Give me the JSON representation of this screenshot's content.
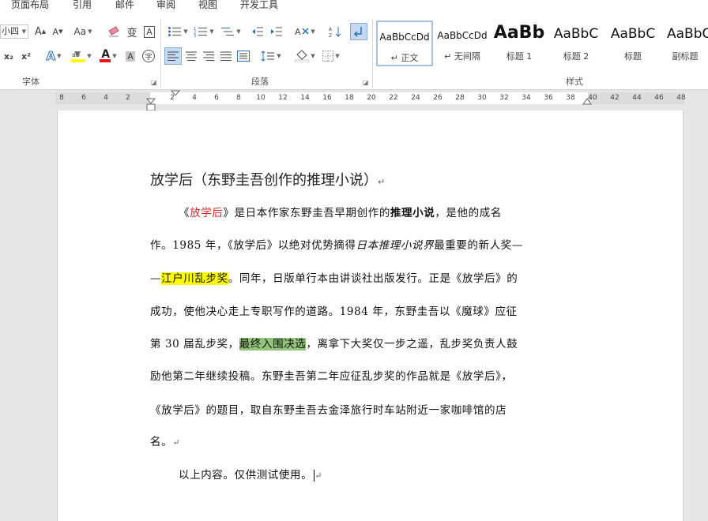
{
  "menu": {
    "tabs": [
      "页面布局",
      "引用",
      "邮件",
      "审阅",
      "视图",
      "开发工具"
    ]
  },
  "font_group": {
    "font_size": "小四",
    "grow_font": "A",
    "shrink_font": "A",
    "change_case": "Aa",
    "phonetic_guide": "变",
    "char_border": "A",
    "subscript": "x₂",
    "superscript": "x²",
    "text_effects": "A",
    "font_color": "A",
    "char_shading": "A",
    "enclose_char": "字",
    "label": "字体"
  },
  "paragraph_group": {
    "label": "段落"
  },
  "styles_group": {
    "label": "样式",
    "items": [
      {
        "sample": "AaBbCcDd",
        "name": "↵ 正文"
      },
      {
        "sample": "AaBbCcDd",
        "name": "↵ 无间隔"
      },
      {
        "sample": "AaBb",
        "name": "标题 1"
      },
      {
        "sample": "AaBbC",
        "name": "标题 2"
      },
      {
        "sample": "AaBbC",
        "name": "标题"
      },
      {
        "sample": "AaBbC",
        "name": "副标题"
      }
    ]
  },
  "ruler": {
    "ticks": [
      "8",
      "6",
      "4",
      "2",
      "2",
      "4",
      "6",
      "8",
      "10",
      "12",
      "14",
      "16",
      "18",
      "20",
      "22",
      "24",
      "26",
      "28",
      "30",
      "32",
      "34",
      "36",
      "38",
      "40",
      "42",
      "44",
      "46",
      "48"
    ]
  },
  "document": {
    "title": "放学后（东野圭吾创作的推理小说）",
    "title_mark": "↵",
    "p1_l1": [
      "《",
      "放学后",
      "》是日本作家东野圭吾早期创作的",
      "推理小说",
      "，是他的成名"
    ],
    "p1_l2": [
      "作。1985 年，《放学后》以绝对优势摘得",
      "日本推理小说界",
      "最重要的新人奖—"
    ],
    "p1_l3": [
      "—",
      "江户川乱步奖",
      "。同年，日版单行本由讲谈社出版发行。正是《放学后》的"
    ],
    "p1_l4": "成功，使他决心走上专职写作的道路。1984 年，东野圭吾以《魔球》应征",
    "p1_l5": [
      "第 30 届乱步奖，",
      "最终入围决选",
      "，离拿下大奖仅一步之遥，乱步奖负责人鼓"
    ],
    "p1_l6": "励他第二年继续投稿。东野圭吾第二年应征乱步奖的作品就是《放学后》，",
    "p1_l7": "《放学后》的题目，取自东野圭吾去金泽旅行时车站附近一家咖啡馆的店",
    "p1_l8": "名。",
    "p1_mark": "↵",
    "p2": "以上内容。仅供测试使用。",
    "p2_mark": "↵"
  }
}
